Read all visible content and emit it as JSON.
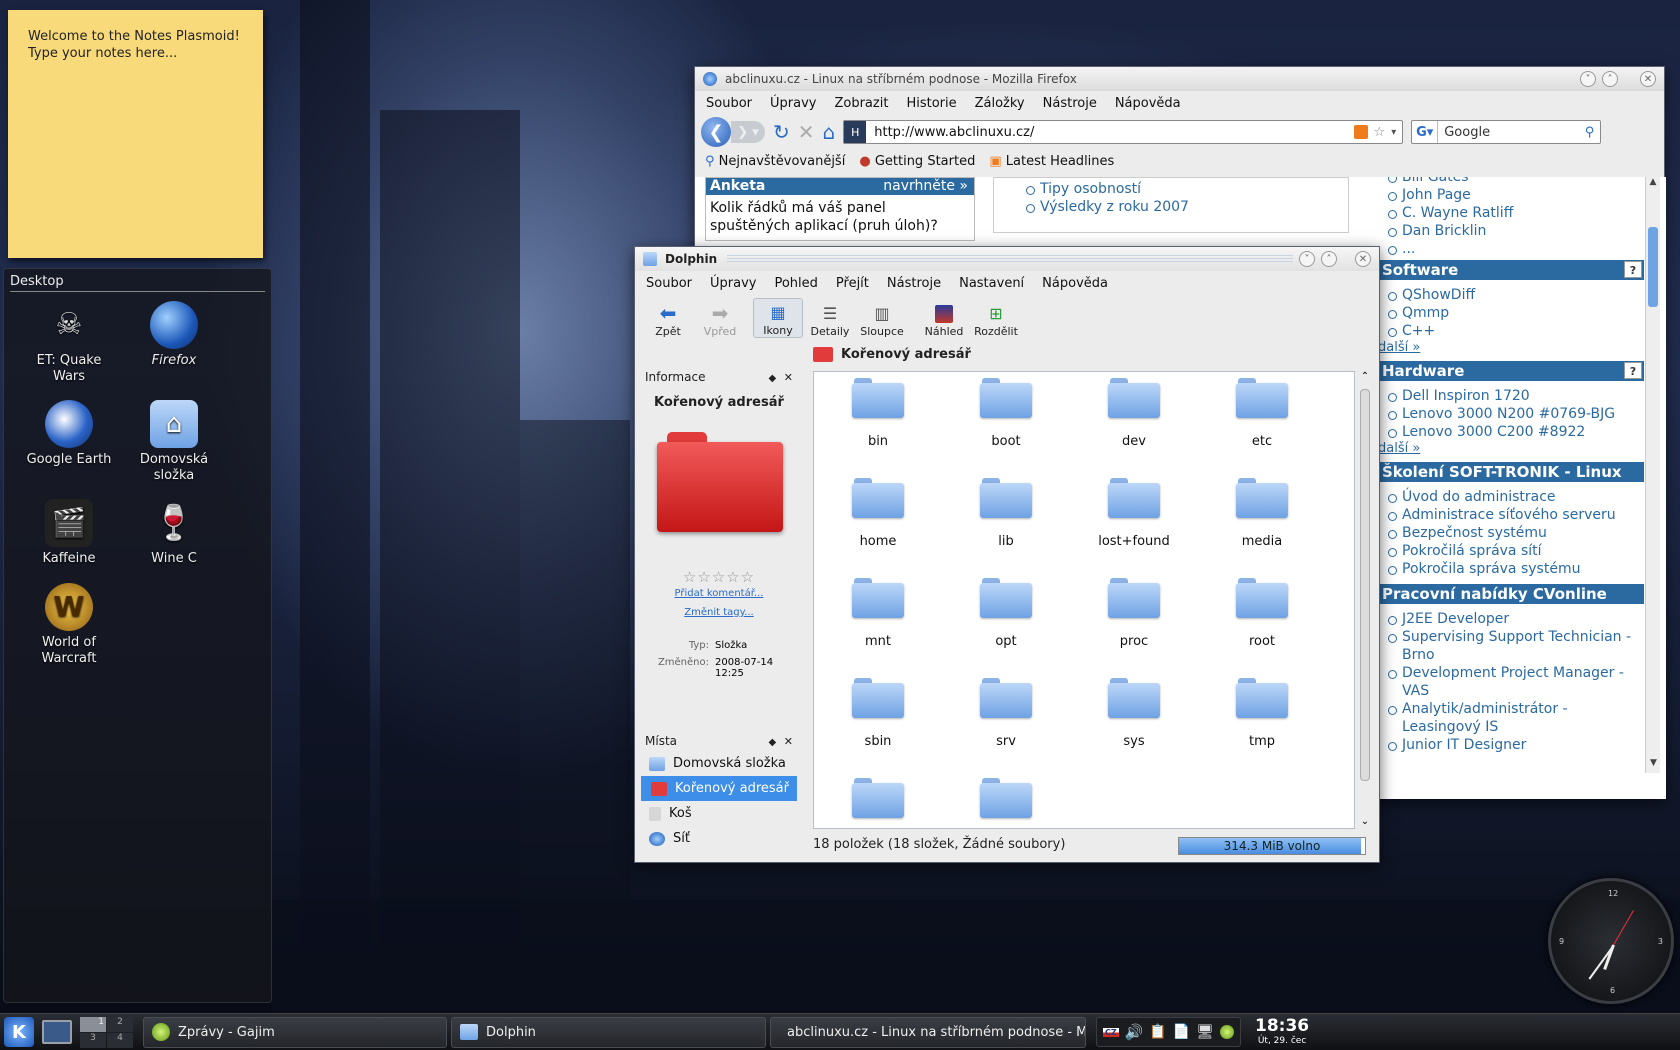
{
  "notes": {
    "line1": "Welcome to the Notes Plasmoid!",
    "line2": "Type your notes here..."
  },
  "desktop": {
    "title": "Desktop",
    "icons": [
      {
        "label": "ET: Quake Wars",
        "icon": "quake-wars-icon"
      },
      {
        "label": "Firefox",
        "icon": "firefox-icon"
      },
      {
        "label": "Google Earth",
        "icon": "google-earth-icon"
      },
      {
        "label": "Domovská složka",
        "icon": "home-folder-icon"
      },
      {
        "label": "Kaffeine",
        "icon": "kaffeine-icon"
      },
      {
        "label": "Wine C",
        "icon": "wine-icon"
      },
      {
        "label": "World of Warcraft",
        "icon": "wow-icon"
      }
    ]
  },
  "firefox": {
    "title": "abclinuxu.cz - Linux na stříbrném podnose - Mozilla Firefox",
    "menu": [
      "Soubor",
      "Úpravy",
      "Zobrazit",
      "Historie",
      "Záložky",
      "Nástroje",
      "Nápověda"
    ],
    "url": "http://www.abclinuxu.cz/",
    "search_engine": "Google",
    "bookmarks": [
      "Nejnavštěvovanější",
      "Getting Started",
      "Latest Headlines"
    ],
    "content": {
      "anketa_title": "Anketa",
      "anketa_link": "navrhněte »",
      "anketa_question": "Kolik řádků má váš panel spuštěných aplikací (pruh úloh)?",
      "mid_links": [
        "Tipy osobností",
        "Výsledky z roku 2007"
      ],
      "people": [
        "Bill Gates",
        "John Page",
        "C. Wayne Ratliff",
        "Dan Bricklin",
        "..."
      ],
      "software_title": "Software",
      "software": [
        "QShowDiff",
        "Qmmp",
        "C++"
      ],
      "more1": "další »",
      "hardware_title": "Hardware",
      "hardware": [
        "Dell Inspiron 1720",
        "Lenovo 3000 N200 #0769-BJG",
        "Lenovo 3000 C200 #8922"
      ],
      "more2": "další »",
      "training_title": "Školení SOFT-TRONIK - Linux",
      "training": [
        "Úvod do administrace",
        "Administrace síťového serveru",
        "Bezpečnost systému",
        "Pokročilá správa sítí",
        "Pokročila správa systému"
      ],
      "jobs_title": "Pracovní nabídky CVonline",
      "jobs": [
        "J2EE Developer",
        "Supervising Support Technician - Brno",
        "Development Project Manager - VAS",
        "Analytik/administrátor - Leasingový IS",
        "Junior IT Designer"
      ],
      "help_mark": "?"
    }
  },
  "dolphin": {
    "title": "Dolphin",
    "menu": [
      "Soubor",
      "Úpravy",
      "Pohled",
      "Přejít",
      "Nástroje",
      "Nastavení",
      "Nápověda"
    ],
    "toolbar": [
      "Zpět",
      "Vpřed",
      "Ikony",
      "Detaily",
      "Sloupce",
      "Náhled",
      "Rozdělit"
    ],
    "info_panel": {
      "title": "Informace",
      "name": "Kořenový adresář",
      "add_comment": "Přidat komentář...",
      "change_tags": "Změnit tagy...",
      "type_label": "Typ:",
      "type_value": "Složka",
      "modified_label": "Změněno:",
      "modified_date": "2008-07-14",
      "modified_time": "12:25"
    },
    "places_panel": {
      "title": "Místa",
      "items": [
        "Domovská složka",
        "Kořenový adresář",
        "Koš",
        "Síť"
      ]
    },
    "location": "Kořenový adresář",
    "folders": [
      "bin",
      "boot",
      "dev",
      "etc",
      "home",
      "lib",
      "lost+found",
      "media",
      "mnt",
      "opt",
      "proc",
      "root",
      "sbin",
      "srv",
      "sys",
      "tmp",
      "",
      ""
    ],
    "status": "18 položek (18 složek, Žádné soubory)",
    "free_space": "314.3 MiB volno",
    "free_fraction": 0.98
  },
  "taskbar": {
    "pager": [
      "1",
      "2",
      "3",
      "4"
    ],
    "tasks": [
      "Zprávy - Gajim",
      "Dolphin",
      "abclinuxu.cz - Linux na stříbrném podnose - M"
    ],
    "time": "18:36",
    "date": "Út, 29. čec",
    "kb_layout": "CZ"
  },
  "clock": {
    "n12": "12",
    "n3": "3",
    "n6": "6",
    "n9": "9"
  },
  "colors": {
    "accent": "#2b6aa1",
    "selection": "#3d8ee8",
    "note": "#f9da7a"
  }
}
